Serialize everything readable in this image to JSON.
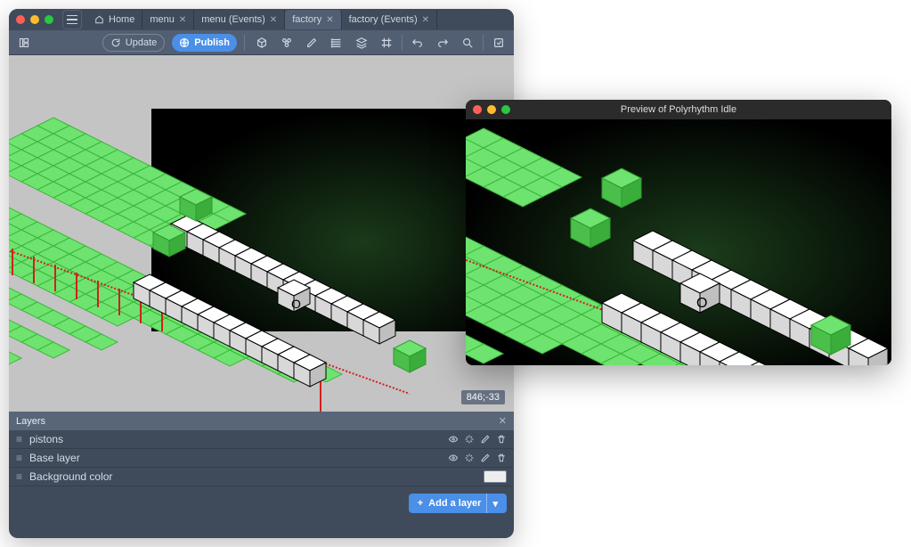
{
  "editor": {
    "tabs": [
      {
        "label": "Home",
        "closable": false,
        "icon": "home"
      },
      {
        "label": "menu",
        "closable": true
      },
      {
        "label": "menu (Events)",
        "closable": true
      },
      {
        "label": "factory",
        "closable": true,
        "active": true
      },
      {
        "label": "factory (Events)",
        "closable": true
      }
    ],
    "toolbar": {
      "update_label": "Update",
      "publish_label": "Publish"
    },
    "coord": "846;-33",
    "layers_title": "Layers",
    "layers": [
      {
        "name": "pistons",
        "visible": true,
        "type": "tile"
      },
      {
        "name": "Base layer",
        "visible": true,
        "type": "tile"
      },
      {
        "name": "Background color",
        "type": "color",
        "swatch": "#eeeeee"
      }
    ],
    "add_layer_label": "Add a layer",
    "colors": {
      "grass": "#6fe36f",
      "grass_dark": "#3bb83b",
      "grass_side": "#54c754",
      "cube_top": "#ffffff",
      "cube_side1": "#d8d8d8",
      "cube_side2": "#bfbfbf",
      "redline": "#d21f1f"
    }
  },
  "preview": {
    "title": "Preview of Polyrhythm Idle"
  }
}
